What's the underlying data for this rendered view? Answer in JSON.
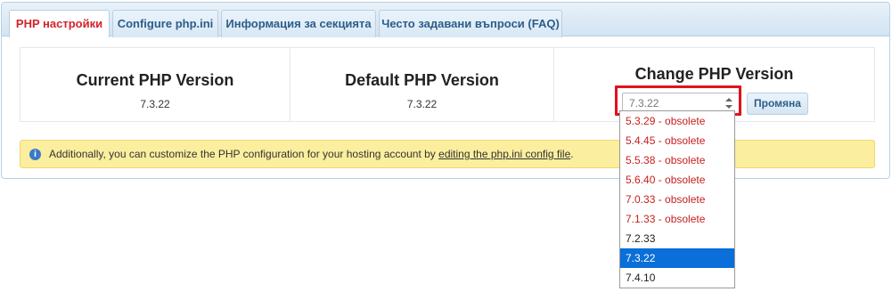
{
  "tabs": [
    {
      "label": "PHP настройки",
      "active": true
    },
    {
      "label": "Configure php.ini",
      "active": false
    },
    {
      "label": "Информация за секцията",
      "active": false
    },
    {
      "label": "Често задавани въпроси (FAQ)",
      "active": false
    }
  ],
  "current": {
    "title": "Current PHP Version",
    "value": "7.3.22"
  },
  "default": {
    "title": "Default PHP Version",
    "value": "7.3.22"
  },
  "change": {
    "title": "Change PHP Version",
    "selected_value": "7.3.22",
    "button_label": "Промяна",
    "options": [
      {
        "label": "5.3.29 - obsolete",
        "obsolete": true,
        "selected": false
      },
      {
        "label": "5.4.45 - obsolete",
        "obsolete": true,
        "selected": false
      },
      {
        "label": "5.5.38 - obsolete",
        "obsolete": true,
        "selected": false
      },
      {
        "label": "5.6.40 - obsolete",
        "obsolete": true,
        "selected": false
      },
      {
        "label": "7.0.33 - obsolete",
        "obsolete": true,
        "selected": false
      },
      {
        "label": "7.1.33 - obsolete",
        "obsolete": true,
        "selected": false
      },
      {
        "label": "7.2.33",
        "obsolete": false,
        "selected": false
      },
      {
        "label": "7.3.22",
        "obsolete": false,
        "selected": true
      },
      {
        "label": "7.4.10",
        "obsolete": false,
        "selected": false
      }
    ]
  },
  "notice": {
    "icon": "info-icon",
    "text_before": "Additionally, you can customize the PHP configuration for your hosting account by ",
    "link_text": "editing the php.ini config file",
    "text_after": "."
  },
  "colors": {
    "active_tab_text": "#d2242c",
    "tab_text": "#2d5d8a",
    "obsolete_option": "#c81e1e",
    "selected_option_bg": "#0a6fd8",
    "highlight_frame": "#e0121c",
    "notice_bg": "#fbee9e"
  }
}
